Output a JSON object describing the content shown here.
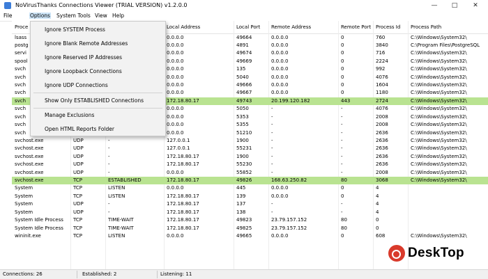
{
  "window": {
    "title": "NoVirusThanks Connections Viewer (TRIAL VERSION) v1.2.0.0",
    "minimize_glyph": "—",
    "maximize_glyph": "□",
    "close_glyph": "✕"
  },
  "menu": [
    "File",
    "Options",
    "System Tools",
    "View",
    "Help"
  ],
  "options_menu": {
    "items": [
      "Ignore SYSTEM Process",
      "Ignore Blank Remote Addresses",
      "Ignore Reserved IP Addresses",
      "Ignore Loopback Connections",
      "Ignore UDP Connections",
      "Show Only ESTABLISHED Connections",
      "Manage Exclusions",
      "Open HTML Reports Folder"
    ]
  },
  "columns": [
    "Proce",
    "",
    "",
    "Local Address",
    "Local Port",
    "Remote Address",
    "Remote Port",
    "Process Id",
    "Process Path"
  ],
  "rows": [
    [
      "lsass",
      "",
      "",
      "0.0.0.0",
      "49664",
      "0.0.0.0",
      "0",
      "760",
      "C:\\Windows\\System32\\"
    ],
    [
      "postg",
      "",
      "",
      "0.0.0.0",
      "4891",
      "0.0.0.0",
      "0",
      "3840",
      "C:\\Program Files\\PostgreSQL"
    ],
    [
      "servi",
      "",
      "",
      "0.0.0.0",
      "49674",
      "0.0.0.0",
      "0",
      "716",
      "C:\\Windows\\System32\\"
    ],
    [
      "spool",
      "",
      "",
      "0.0.0.0",
      "49669",
      "0.0.0.0",
      "0",
      "2224",
      "C:\\Windows\\System32\\"
    ],
    [
      "svch",
      "",
      "",
      "0.0.0.0",
      "135",
      "0.0.0.0",
      "0",
      "992",
      "C:\\Windows\\System32\\"
    ],
    [
      "svch",
      "",
      "",
      "0.0.0.0",
      "5040",
      "0.0.0.0",
      "0",
      "4076",
      "C:\\Windows\\System32\\"
    ],
    [
      "svch",
      "",
      "",
      "0.0.0.0",
      "49666",
      "0.0.0.0",
      "0",
      "1604",
      "C:\\Windows\\System32\\"
    ],
    [
      "svch",
      "",
      "",
      "0.0.0.0",
      "49667",
      "0.0.0.0",
      "0",
      "1180",
      "C:\\Windows\\System32\\"
    ],
    [
      "svch",
      "",
      "",
      "172.18.80.17",
      "49743",
      "20.199.120.182",
      "443",
      "2724",
      "C:\\Windows\\System32\\"
    ],
    [
      "svch",
      "",
      "",
      "0.0.0.0",
      "5050",
      "-",
      "-",
      "4076",
      "C:\\Windows\\System32\\"
    ],
    [
      "svch",
      "",
      "",
      "0.0.0.0",
      "5353",
      "-",
      "-",
      "2008",
      "C:\\Windows\\System32\\"
    ],
    [
      "svch",
      "",
      "",
      "0.0.0.0",
      "5355",
      "-",
      "-",
      "2008",
      "C:\\Windows\\System32\\"
    ],
    [
      "svch",
      "",
      "",
      "0.0.0.0",
      "51210",
      "-",
      "-",
      "2636",
      "C:\\Windows\\System32\\"
    ],
    [
      "svchost.exe",
      "UDP",
      "-",
      "127.0.0.1",
      "1900",
      "-",
      "-",
      "2636",
      "C:\\Windows\\System32\\"
    ],
    [
      "svchost.exe",
      "UDP",
      "-",
      "127.0.0.1",
      "55231",
      "-",
      "-",
      "2636",
      "C:\\Windows\\System32\\"
    ],
    [
      "svchost.exe",
      "UDP",
      "-",
      "172.18.80.17",
      "1900",
      "-",
      "-",
      "2636",
      "C:\\Windows\\System32\\"
    ],
    [
      "svchost.exe",
      "UDP",
      "-",
      "172.18.80.17",
      "55230",
      "-",
      "-",
      "2636",
      "C:\\Windows\\System32\\"
    ],
    [
      "svchost.exe",
      "UDP",
      "-",
      "0.0.0.0",
      "55852",
      "-",
      "-",
      "2008",
      "C:\\Windows\\System32\\"
    ],
    [
      "svchost.exe",
      "TCP",
      "ESTABLISHED",
      "172.18.80.17",
      "49826",
      "168.63.250.82",
      "80",
      "3068",
      "C:\\Windows\\System32\\"
    ],
    [
      "System",
      "TCP",
      "LISTEN",
      "0.0.0.0",
      "445",
      "0.0.0.0",
      "0",
      "4",
      ""
    ],
    [
      "System",
      "TCP",
      "LISTEN",
      "172.18.80.17",
      "139",
      "0.0.0.0",
      "0",
      "4",
      ""
    ],
    [
      "System",
      "UDP",
      "-",
      "172.18.80.17",
      "137",
      "-",
      "-",
      "4",
      ""
    ],
    [
      "System",
      "UDP",
      "-",
      "172.18.80.17",
      "138",
      "-",
      "-",
      "4",
      ""
    ],
    [
      "System Idle Process",
      "TCP",
      "TIME-WAIT",
      "172.18.80.17",
      "49823",
      "23.79.157.152",
      "80",
      "0",
      ""
    ],
    [
      "System Idle Process",
      "TCP",
      "TIME-WAIT",
      "172.18.80.17",
      "49825",
      "23.79.157.152",
      "80",
      "0",
      ""
    ],
    [
      "wininit.exe",
      "TCP",
      "LISTEN",
      "0.0.0.0",
      "49665",
      "0.0.0.0",
      "0",
      "608",
      "C:\\Windows\\System32\\"
    ]
  ],
  "highlighted_rows": [
    8,
    18
  ],
  "highlight_color": "#b9e391",
  "status": {
    "connections": "Connections: 26",
    "established": "Established: 2",
    "listening": "Listening: 11"
  },
  "watermark": {
    "text": "DeskTop",
    "color": "#d93a2b"
  }
}
